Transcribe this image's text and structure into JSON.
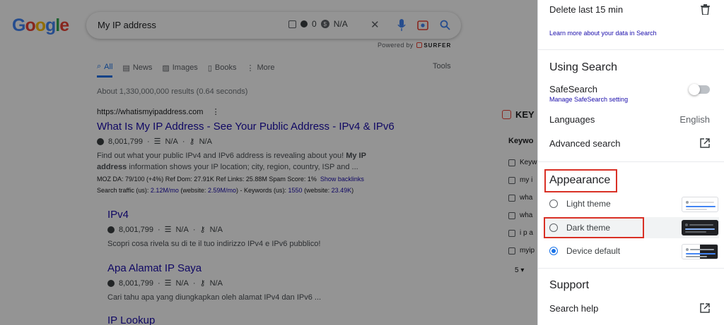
{
  "logo": "Google",
  "search": {
    "query": "My IP address",
    "ext_count": "0",
    "ext_value": "N/A",
    "powered_by": "Powered by",
    "surfer": "SURFER"
  },
  "tabs": [
    {
      "label": "All",
      "icon": "search-icon"
    },
    {
      "label": "News",
      "icon": "news-icon"
    },
    {
      "label": "Images",
      "icon": "image-icon"
    },
    {
      "label": "Books",
      "icon": "book-icon"
    },
    {
      "label": "More",
      "icon": "more-vert-icon"
    }
  ],
  "tools_label": "Tools",
  "stats": "About 1,330,000,000 results (0.64 seconds)",
  "result1": {
    "url": "https://whatismyipaddress.com",
    "title": "What Is My IP Address - See Your Public Address - IPv4 & IPv6",
    "traffic": "8,001,799",
    "m2": "N/A",
    "m3": "N/A",
    "snippet_a": "Find out what your public IPv4 and IPv6 address is revealing about you!",
    "snippet_bold": "My IP address",
    "snippet_b": "information shows your IP location; city, region, country, ISP and ...",
    "moz_line": "MOZ DA: 79/100 (+4%)   Ref Dom: 27.91K   Ref Links: 25.88M   Spam Score: 1%",
    "backlinks": "Show backlinks",
    "traffic_label": "Search traffic (us):",
    "traffic_val": "2.12M/mo",
    "web_label": "(website:",
    "web_val": "2.59M/mo",
    "kw_label": ") - Keywords (us):",
    "kw_val": "1550",
    "kw_web_label": "(website:",
    "kw_web_val": "23.49K",
    "close_paren": ")"
  },
  "sub1": {
    "title": "IPv4",
    "traffic": "8,001,799",
    "m2": "N/A",
    "m3": "N/A",
    "snippet": "Scopri cosa rivela su di te il tuo indirizzo IPv4 e IPv6 pubblico!"
  },
  "sub2": {
    "title": "Apa Alamat IP Saya",
    "traffic": "8,001,799",
    "m2": "N/A",
    "m3": "N/A",
    "snippet": "Cari tahu apa yang diungkapkan oleh alamat IPv4 dan IPv6 ..."
  },
  "sub3": {
    "title": "IP Lookup"
  },
  "kw_panel": {
    "head": "KEY",
    "sub": "Keywo",
    "rows": [
      "Keyw",
      "my i",
      "wha",
      "wha",
      "i p a",
      "myip"
    ],
    "page": "5"
  },
  "panel": {
    "delete": "Delete last 15 min",
    "learn_more": "Learn more about your data in Search",
    "using_search": "Using Search",
    "safesearch": "SafeSearch",
    "manage_safesearch": "Manage SafeSearch setting",
    "languages": "Languages",
    "languages_value": "English",
    "advanced": "Advanced search",
    "appearance": "Appearance",
    "light": "Light theme",
    "dark": "Dark theme",
    "device": "Device default",
    "support": "Support",
    "help": "Search help"
  },
  "colors": {
    "accent": "#1a73e8",
    "highlight": "#d93025",
    "link": "#1a0dab"
  }
}
